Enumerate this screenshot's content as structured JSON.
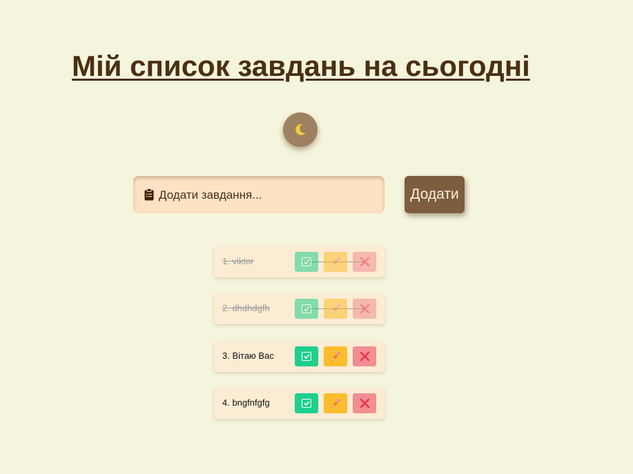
{
  "header": {
    "title": "Мій список завдань на сьогодні"
  },
  "theme_toggle": {
    "icon": "moon-icon",
    "icon_color": "#f4c93c"
  },
  "task_input": {
    "value": "",
    "placeholder": "Додати завдання...",
    "icon": "clipboard-icon"
  },
  "add_button": {
    "label": "Додати"
  },
  "tasks": [
    {
      "label": "1. viktor",
      "completed": true
    },
    {
      "label": "2. dhdhdgfh",
      "completed": true
    },
    {
      "label": "3. Вітаю Вас",
      "completed": false
    },
    {
      "label": "4. bngfnfgfg",
      "completed": false
    }
  ],
  "actions": {
    "complete_icon": "check-icon",
    "edit_icon": "pencil-icon",
    "delete_icon": "close-icon"
  },
  "colors": {
    "background": "#f5f4dc",
    "title": "#4a2f12",
    "add_button": "#7e5d3f",
    "complete": "#1fcf8d",
    "edit": "#fbbd2e",
    "delete": "#f08e93",
    "delete_icon": "#e8354a"
  }
}
